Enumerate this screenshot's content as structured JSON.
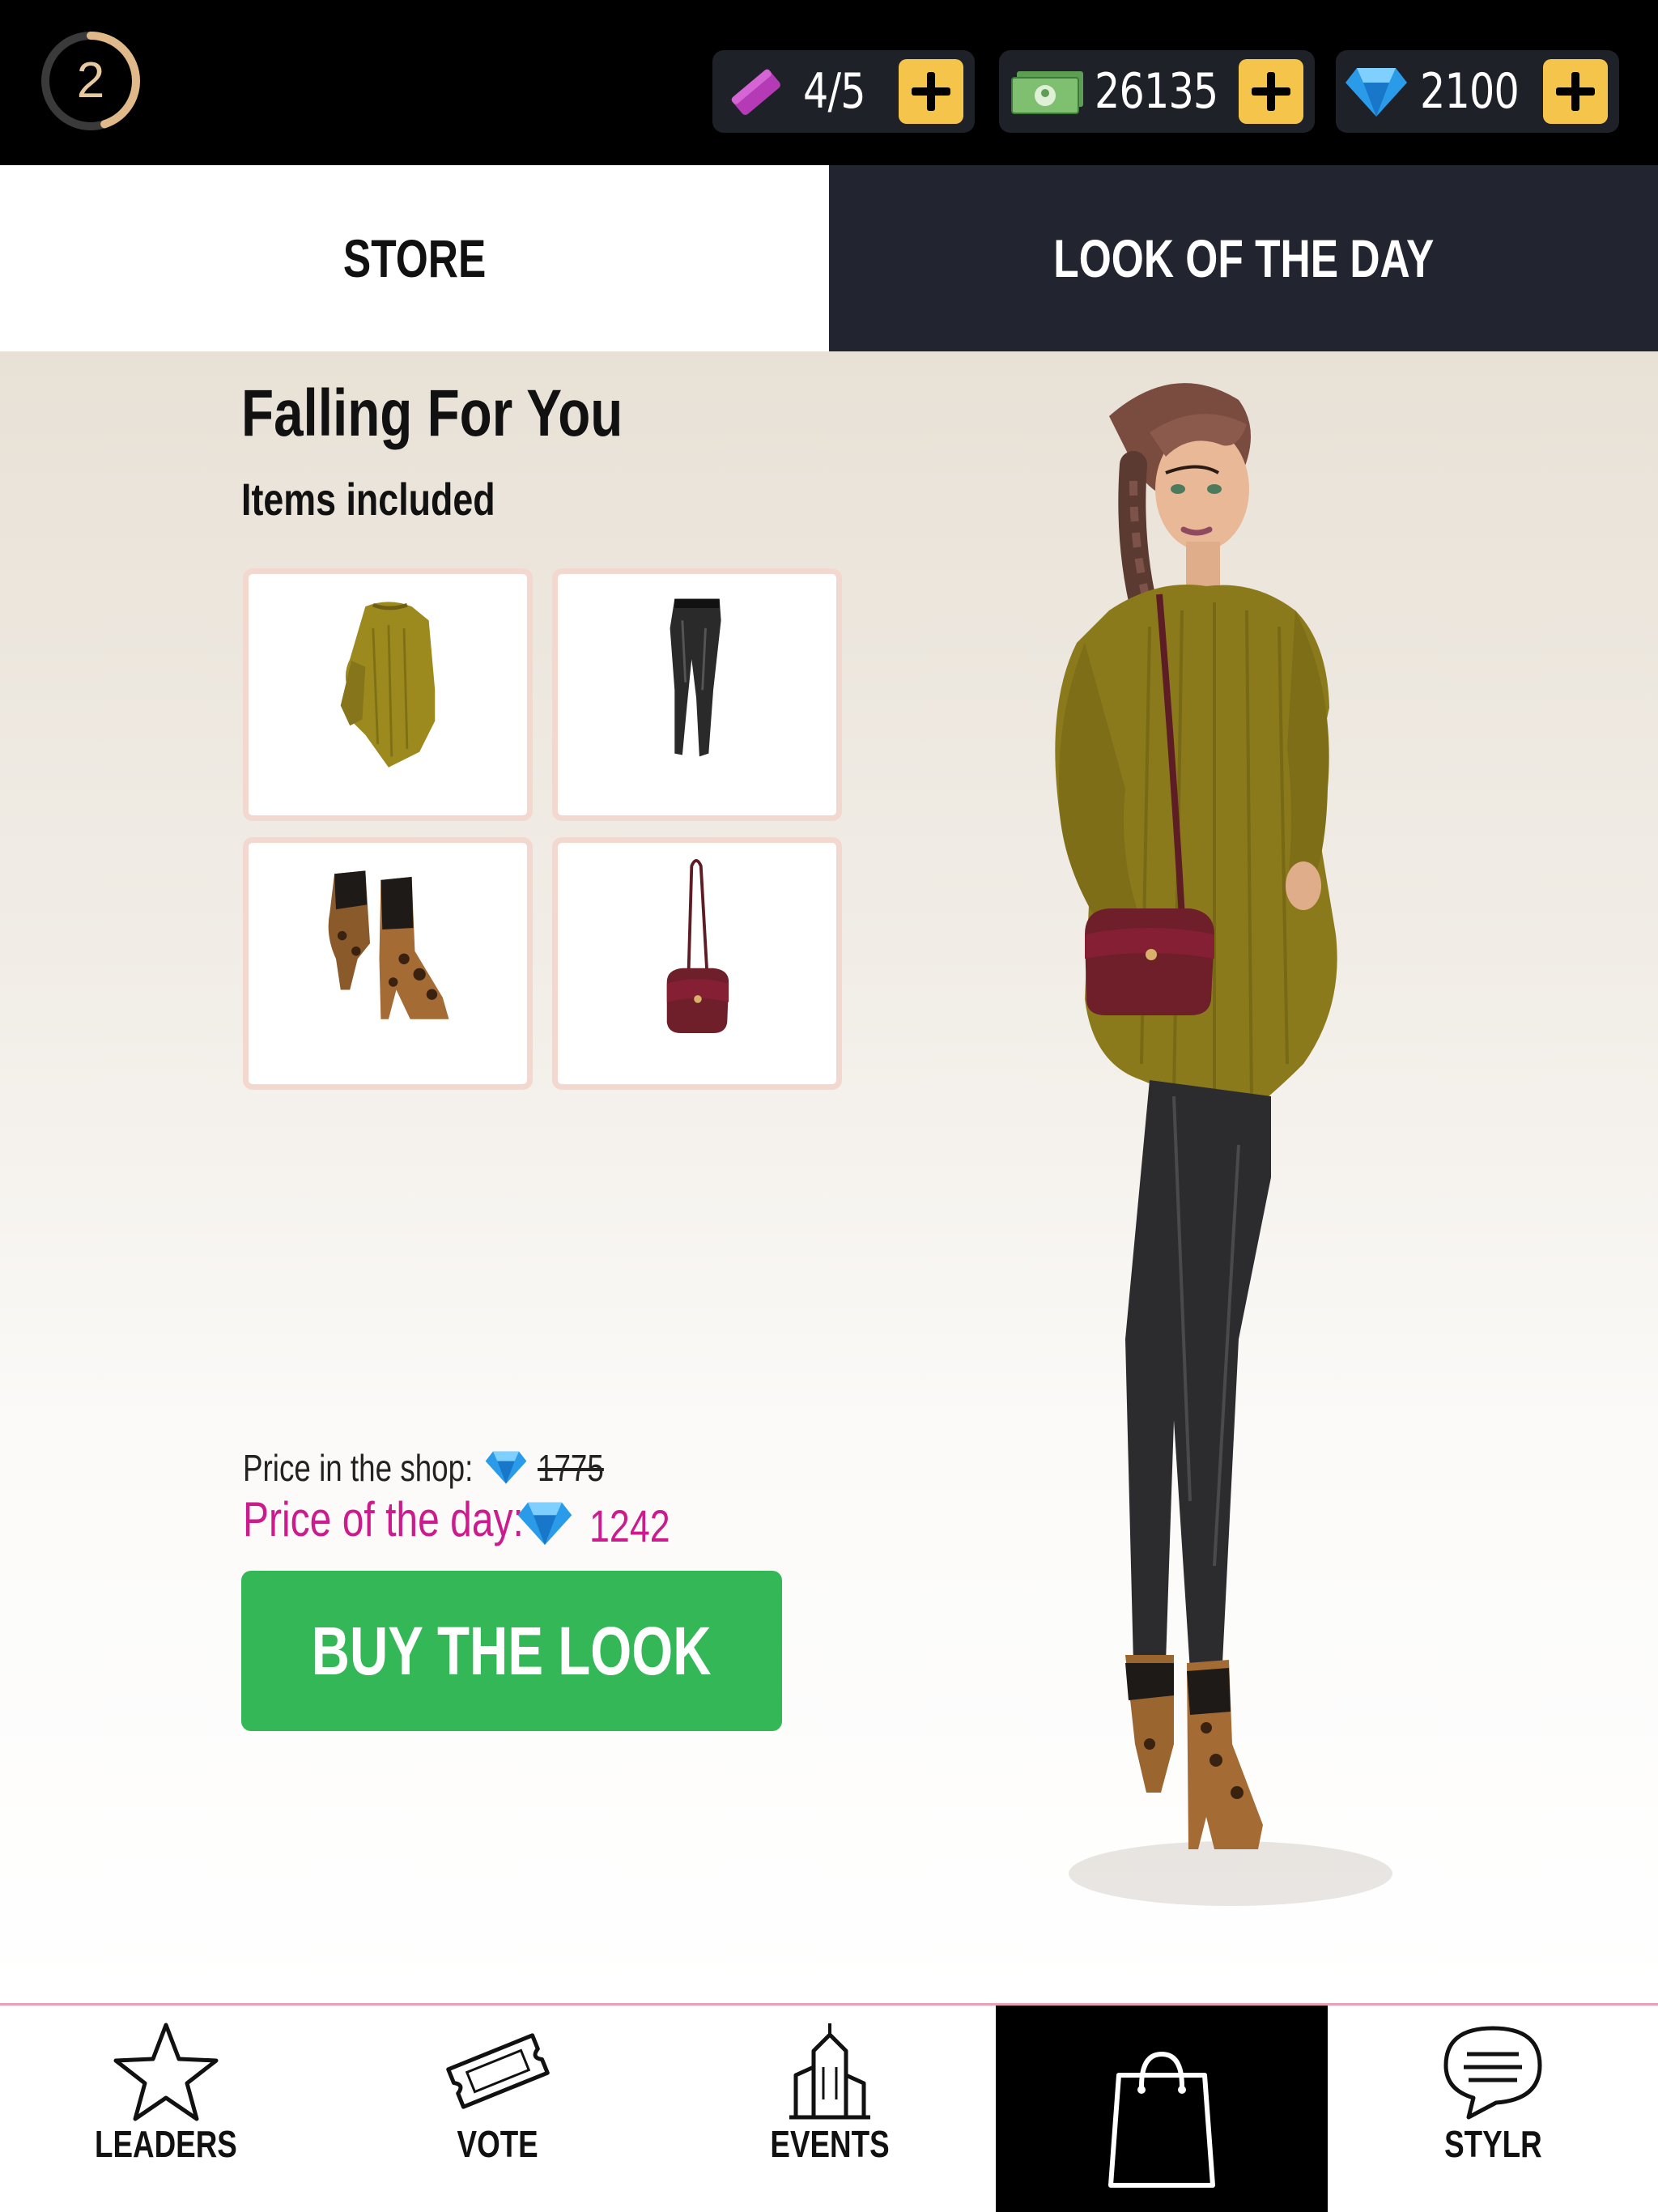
{
  "header": {
    "level": "2",
    "level_progress": 0.45,
    "tickets": {
      "value": "4/5",
      "icon": "ticket-icon"
    },
    "cash": {
      "value": "26135",
      "icon": "cash-icon"
    },
    "gems": {
      "value": "2100",
      "icon": "diamond-icon"
    }
  },
  "tabs": [
    {
      "label": "STORE",
      "active": false
    },
    {
      "label": "LOOK OF THE DAY",
      "active": true
    }
  ],
  "look": {
    "title": "Falling For You",
    "items_heading": "Items included",
    "items": [
      {
        "name": "mustard sweater",
        "icon": "sweater-icon"
      },
      {
        "name": "black leather pants",
        "icon": "pants-icon"
      },
      {
        "name": "leopard ankle boots",
        "icon": "boots-icon"
      },
      {
        "name": "burgundy crossbody bag",
        "icon": "bag-icon"
      }
    ],
    "price_shop_label": "Price in the shop:",
    "price_shop_value": "1775",
    "price_day_label": "Price of the day:",
    "price_day_value": "1242",
    "buy_button": "BUY THE LOOK"
  },
  "bottom_nav": [
    {
      "label": "LEADERS",
      "icon": "star-icon"
    },
    {
      "label": "VOTE",
      "icon": "ticket-outline-icon"
    },
    {
      "label": "EVENTS",
      "icon": "buildings-icon"
    },
    {
      "label": "",
      "icon": "shopping-bag-icon",
      "active": true
    },
    {
      "label": "STYLR",
      "icon": "chat-bubble-icon"
    }
  ],
  "colors": {
    "accent_pink": "#cc1b8d",
    "buy_green": "#33b757",
    "plus_yellow": "#f4c54a",
    "tab_dark": "#222430"
  }
}
